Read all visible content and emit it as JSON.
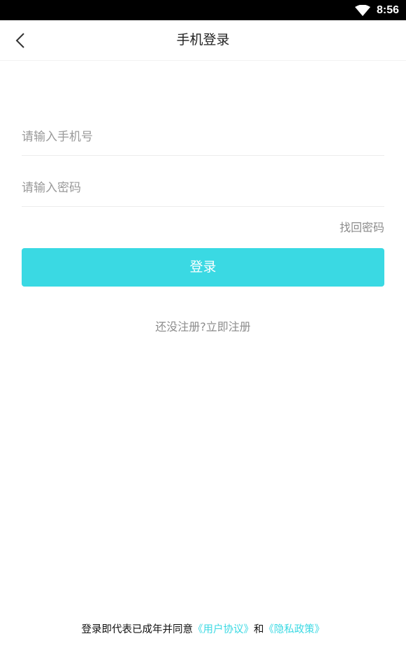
{
  "status_bar": {
    "time": "8:56",
    "wifi_icon": "wifi-icon"
  },
  "nav": {
    "back_icon": "chevron-left-icon",
    "title": "手机登录"
  },
  "form": {
    "phone_placeholder": "请输入手机号",
    "password_placeholder": "请输入密码",
    "forgot_password": "找回密码",
    "login_button": "登录"
  },
  "register": {
    "prompt": "还没注册?",
    "link": "立即注册"
  },
  "agreement": {
    "prefix": "登录即代表已成年并同意",
    "user_agreement": "《用户协议》",
    "conjunction": "和",
    "privacy_policy": "《隐私政策》"
  },
  "colors": {
    "accent": "#3ad9e3",
    "status_bar_bg": "#000000",
    "placeholder": "#9a9a9a"
  }
}
